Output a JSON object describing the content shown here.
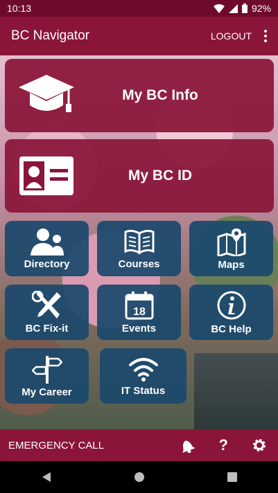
{
  "status": {
    "time": "10:13",
    "battery": "92%"
  },
  "appbar": {
    "title": "BC Navigator",
    "logout": "LOGOUT"
  },
  "tiles_wide": [
    {
      "label": "My BC Info",
      "icon": "graduation-cap-icon"
    },
    {
      "label": "My BC ID",
      "icon": "id-card-icon"
    }
  ],
  "tiles": [
    {
      "label": "Directory",
      "icon": "people-icon"
    },
    {
      "label": "Courses",
      "icon": "open-book-icon"
    },
    {
      "label": "Maps",
      "icon": "map-pin-icon"
    },
    {
      "label": "BC Fix-it",
      "icon": "tools-icon"
    },
    {
      "label": "Events",
      "icon": "calendar-icon",
      "day": "18"
    },
    {
      "label": "BC Help",
      "icon": "info-icon"
    },
    {
      "label": "My Career",
      "icon": "signpost-icon"
    },
    {
      "label": "IT Status",
      "icon": "wifi-icon"
    }
  ],
  "bottombar": {
    "emergency": "EMERGENCY CALL",
    "help": "?"
  },
  "colors": {
    "maroon": "#8a1538",
    "tile_blue": "#1a496d",
    "status_bar": "#6e0b2c"
  }
}
